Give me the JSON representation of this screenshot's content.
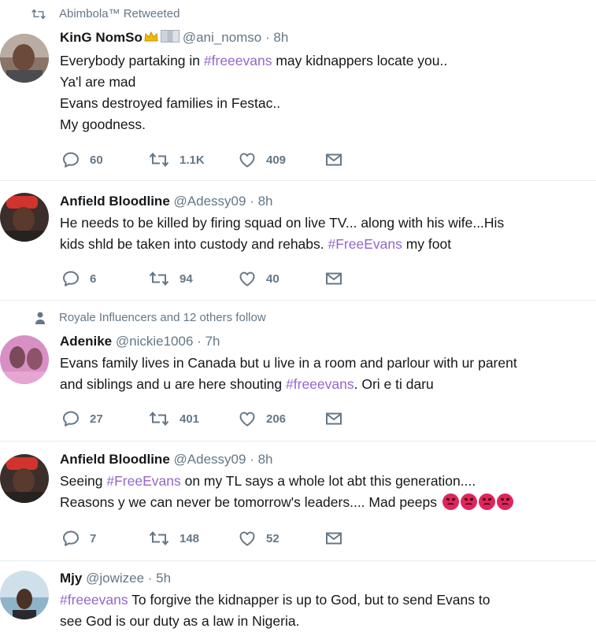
{
  "colors": {
    "hashtag": "#9266cc",
    "muted": "#657786",
    "text": "#14171a",
    "divider": "#e6ecf0",
    "angry_emoji": "#e0245e"
  },
  "tweets": [
    {
      "context": "Abimbola™ Retweeted",
      "context_icon": "retweet-icon",
      "name": "KinG NomSo",
      "handle": "@ani_nomso",
      "dot": "·",
      "time": "8h",
      "lines": [
        {
          "text1": "Everybody partaking in ",
          "hashtag": "#freeevans",
          "text2": " may kidnappers locate you.."
        },
        {
          "text1": "Ya'l are mad"
        },
        {
          "text1": "Evans destroyed families in Festac.."
        },
        {
          "text1": "My goodness."
        }
      ],
      "replies": "60",
      "retweets": "1.1K",
      "likes": "409"
    },
    {
      "name": "Anfield Bloodline",
      "handle": "@Adessy09",
      "dot": "·",
      "time": "8h",
      "lines": [
        {
          "text1": "He needs to be killed by firing squad on live TV... along with his wife...His"
        },
        {
          "text1": "kids shld be taken into custody and rehabs. ",
          "hashtag": "#FreeEvans",
          "text2": " my foot"
        }
      ],
      "replies": "6",
      "retweets": "94",
      "likes": "40"
    },
    {
      "context": "Royale Influencers and 12 others follow",
      "context_icon": "person-icon",
      "name": "Adenike",
      "handle": "@nickie1006",
      "dot": "·",
      "time": "7h",
      "lines": [
        {
          "text1": "Evans family lives in Canada but u live in a room and parlour with ur parent"
        },
        {
          "text1": "and siblings and u are here shouting ",
          "hashtag": "#freeevans",
          "text2": ". Ori e ti daru"
        }
      ],
      "replies": "27",
      "retweets": "401",
      "likes": "206"
    },
    {
      "name": "Anfield Bloodline",
      "handle": "@Adessy09",
      "dot": "·",
      "time": "8h",
      "lines": [
        {
          "text1": "Seeing ",
          "hashtag": "#FreeEvans",
          "text2": " on my TL says a whole lot abt this generation...."
        },
        {
          "text1": "Reasons y we can never be tomorrow's leaders.... Mad peeps "
        }
      ],
      "emoji": "angry-face-emoji",
      "replies": "7",
      "retweets": "148",
      "likes": "52"
    },
    {
      "name": "Mjy",
      "handle": "@jowizee",
      "dot": "·",
      "time": "5h",
      "lines": [
        {
          "hashtag": "#freeevans",
          "text2": " To forgive the kidnapper is up to God, but to send Evans to"
        },
        {
          "text1": "see God is our duty as a law in Nigeria."
        }
      ]
    }
  ]
}
